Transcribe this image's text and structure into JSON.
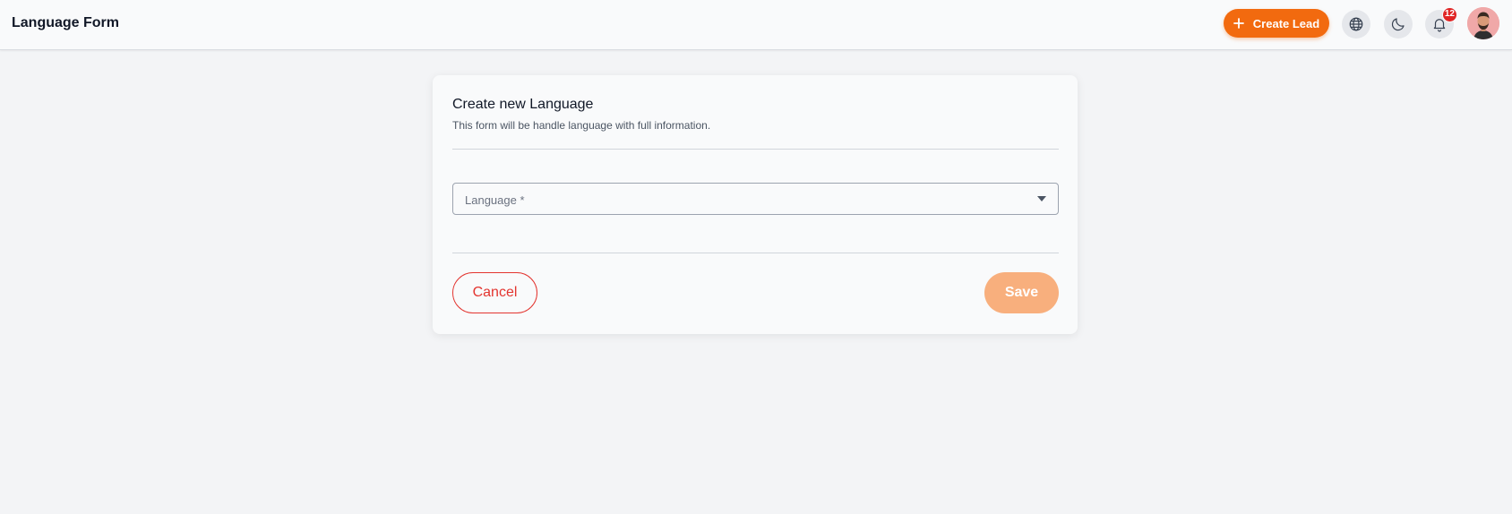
{
  "header": {
    "title": "Language Form",
    "create_lead_label": "Create Lead",
    "create_lead_icon": "plus-icon",
    "language_icon": "globe-icon",
    "theme_icon": "moon-icon",
    "notifications_icon": "bell-icon",
    "notification_count": "12",
    "avatar_icon": "user-avatar"
  },
  "form": {
    "title": "Create new Language",
    "subtitle": "This form will be handle language with full information.",
    "language_placeholder": "Language *",
    "cancel_label": "Cancel",
    "save_label": "Save"
  },
  "colors": {
    "accent": "#f26a0f",
    "save_disabled": "#f8af7d",
    "cancel": "#e3342f",
    "badge": "#e02424"
  }
}
